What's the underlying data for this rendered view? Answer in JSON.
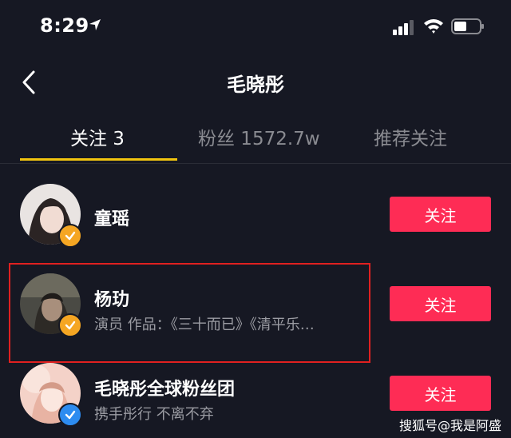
{
  "status_bar": {
    "time": "8:29",
    "icons": [
      "location-arrow-icon",
      "signal-icon",
      "wifi-icon",
      "battery-icon"
    ]
  },
  "header": {
    "back_icon": "chevron-left-icon",
    "title": "毛晓彤"
  },
  "tabs": [
    {
      "label": "关注 3",
      "active": true
    },
    {
      "label": "粉丝 1572.7w",
      "active": false
    },
    {
      "label": "推荐关注",
      "active": false
    }
  ],
  "list": [
    {
      "name": "童瑶",
      "subtitle": "",
      "verified": "gold",
      "button": "关注"
    },
    {
      "name": "杨玏",
      "subtitle": "演员 作品：《三十而已》《清平乐…",
      "verified": "gold",
      "button": "关注"
    },
    {
      "name": "毛晓彤全球粉丝团",
      "subtitle": "携手彤行 不离不弃",
      "verified": "blue",
      "button": "关注"
    }
  ],
  "watermark": "搜狐号@我是阿盛",
  "colors": {
    "background": "#161823",
    "accent_follow": "#fe2c55",
    "tab_underline": "#f1c40f",
    "verified_gold": "#f5a623",
    "verified_blue": "#2d8cf0",
    "highlight_border": "#e02020"
  }
}
